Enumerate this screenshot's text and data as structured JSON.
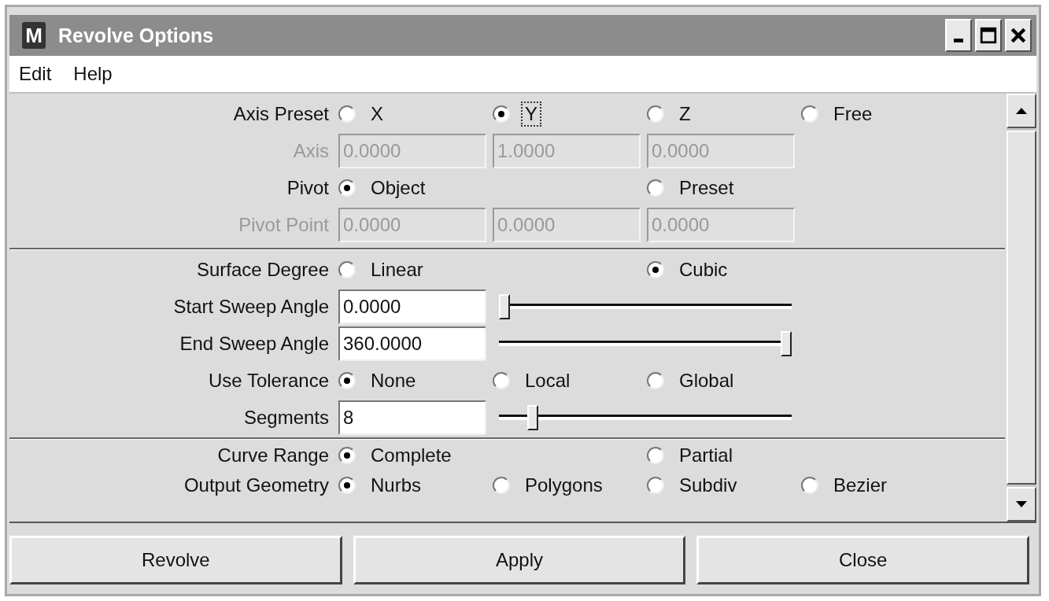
{
  "window": {
    "title": "Revolve Options",
    "logo": "M"
  },
  "menu": [
    "Edit",
    "Help"
  ],
  "sections": [
    {
      "rows": [
        {
          "kind": "radio",
          "label": "Axis Preset",
          "disabled": false,
          "options": [
            {
              "text": "X",
              "selected": false,
              "focused": false
            },
            {
              "text": "Y",
              "selected": true,
              "focused": true
            },
            {
              "text": "Z",
              "selected": false,
              "focused": false
            },
            {
              "text": "Free",
              "selected": false,
              "focused": false
            }
          ]
        },
        {
          "kind": "fields",
          "label": "Axis",
          "disabled": true,
          "values": [
            "0.0000",
            "1.0000",
            "0.0000"
          ]
        },
        {
          "kind": "radio",
          "label": "Pivot",
          "disabled": false,
          "options": [
            {
              "text": "Object",
              "selected": true,
              "focused": false
            },
            {
              "text": "Preset",
              "selected": false,
              "focused": false
            }
          ]
        },
        {
          "kind": "fields",
          "label": "Pivot Point",
          "disabled": true,
          "values": [
            "0.0000",
            "0.0000",
            "0.0000"
          ]
        }
      ]
    },
    {
      "rows": [
        {
          "kind": "radio",
          "label": "Surface Degree",
          "disabled": false,
          "options": [
            {
              "text": "Linear",
              "selected": false,
              "focused": false
            },
            {
              "text": "Cubic",
              "selected": true,
              "focused": false
            }
          ]
        },
        {
          "kind": "slider",
          "label": "Start Sweep Angle",
          "disabled": false,
          "value": "0.0000",
          "level": 0
        },
        {
          "kind": "slider",
          "label": "End Sweep Angle",
          "disabled": false,
          "value": "360.0000",
          "level": 1
        },
        {
          "kind": "radio",
          "label": "Use Tolerance",
          "disabled": false,
          "options": [
            {
              "text": "None",
              "selected": true,
              "focused": false
            },
            {
              "text": "Local",
              "selected": false,
              "focused": false
            },
            {
              "text": "Global",
              "selected": false,
              "focused": false
            }
          ]
        },
        {
          "kind": "slider",
          "label": "Segments",
          "disabled": false,
          "value": "8",
          "level": 0.1
        }
      ]
    },
    {
      "rows": [
        {
          "kind": "radio",
          "label": "Curve Range",
          "disabled": false,
          "options": [
            {
              "text": "Complete",
              "selected": true,
              "focused": false
            },
            {
              "text": "Partial",
              "selected": false,
              "focused": false
            }
          ]
        },
        {
          "kind": "radio",
          "label": "Output Geometry",
          "disabled": false,
          "options": [
            {
              "text": "Nurbs",
              "selected": true,
              "focused": false
            },
            {
              "text": "Polygons",
              "selected": false,
              "focused": false
            },
            {
              "text": "Subdiv",
              "selected": false,
              "focused": false
            },
            {
              "text": "Bezier",
              "selected": false,
              "focused": false
            }
          ]
        }
      ]
    }
  ],
  "buttons": [
    "Revolve",
    "Apply",
    "Close"
  ]
}
